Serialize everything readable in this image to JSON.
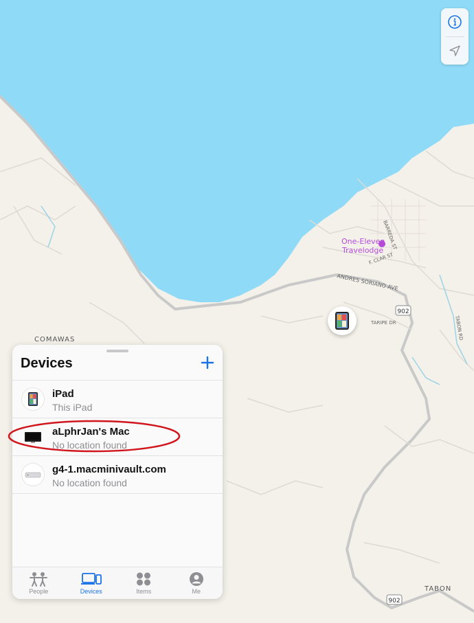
{
  "map": {
    "labels": {
      "hotel_line1": "One-Eleven",
      "hotel_line2": "Travelodge",
      "barreda": "BARREDA ST",
      "clar": "F. CLAR ST",
      "andres": "ANDRES SORIANO AVE",
      "taripe": "TARIPE DR",
      "tabon_rd": "TABON RD",
      "comawas": "COMAWAS",
      "tabon": "TABON",
      "route_shield_1": "902",
      "route_shield_2": "902"
    },
    "colors": {
      "water": "#8fdbf7",
      "land": "#f4f1ea",
      "road": "#c9c9c9",
      "hotel": "#b64ad8"
    }
  },
  "map_controls": {
    "info_icon": "info-circle-icon",
    "location_icon": "location-arrow-icon"
  },
  "devices_panel": {
    "title": "Devices",
    "add_icon": "plus-icon",
    "items": [
      {
        "name": "iPad",
        "status": "This iPad",
        "icon": "ipad-icon"
      },
      {
        "name": "aLphrJan's Mac",
        "status": "No location found",
        "icon": "imac-icon"
      },
      {
        "name": "g4-1.macminivault.com",
        "status": "No location found",
        "icon": "mac-mini-icon"
      }
    ]
  },
  "tabs": [
    {
      "label": "People",
      "icon": "people-icon",
      "active": false
    },
    {
      "label": "Devices",
      "icon": "devices-icon",
      "active": true
    },
    {
      "label": "Items",
      "icon": "items-icon",
      "active": false
    },
    {
      "label": "Me",
      "icon": "me-icon",
      "active": false
    }
  ],
  "accent_color": "#1a73e8",
  "annotation_color": "#d0161c"
}
